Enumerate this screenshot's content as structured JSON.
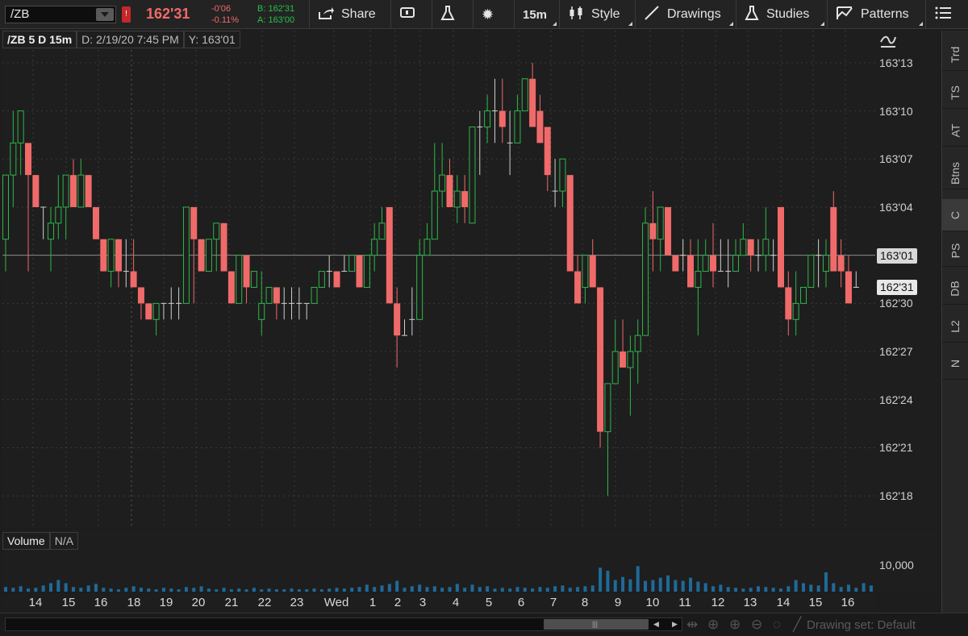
{
  "toolbar": {
    "symbol": "/ZB",
    "alert_badge": "!",
    "last_price": "162'31",
    "net_change": "-0'06",
    "pct_change": "-0.11%",
    "bid": "B: 162'31",
    "ask": "A: 163'00",
    "buttons": [
      {
        "id": "share",
        "label": "Share",
        "icon": "share-icon"
      },
      {
        "id": "messages",
        "label": "",
        "icon": "message-icon"
      },
      {
        "id": "lab",
        "label": "",
        "icon": "flask-icon"
      },
      {
        "id": "settings",
        "label": "",
        "icon": "gear-icon"
      },
      {
        "id": "timeframe",
        "label": "15m",
        "icon": ""
      },
      {
        "id": "style",
        "label": "Style",
        "icon": "candle-icon"
      },
      {
        "id": "drawings",
        "label": "Drawings",
        "icon": "pencil-icon"
      },
      {
        "id": "studies",
        "label": "Studies",
        "icon": "flask-icon"
      },
      {
        "id": "patterns",
        "label": "Patterns",
        "icon": "pattern-icon"
      },
      {
        "id": "grid",
        "label": "",
        "icon": "grid-icon"
      }
    ]
  },
  "info_bar": {
    "symbol_period": "/ZB 5 D 15m",
    "date": "D: 2/19/20 7:45 PM",
    "y_value": "Y: 163'01"
  },
  "volume_header": {
    "label": "Volume",
    "value": "N/A"
  },
  "volume_axis_label": "10,000",
  "sidebar_tabs": [
    "Trd",
    "TS",
    "AT",
    "Btns",
    "C",
    "PS",
    "DB",
    "L2",
    "N"
  ],
  "active_sidebar_tab": "C",
  "bottom": {
    "drawing_set": "Drawing set: Default"
  },
  "colors": {
    "up": "#2db84a",
    "down": "#f06a6a",
    "grid": "#3a3a3a",
    "volume": "#1f6a9a"
  },
  "chart_data": {
    "type": "candlestick",
    "price_unit": "32nds",
    "y_ticks": [
      "163'13",
      "163'10",
      "163'07",
      "163'04",
      "163'01",
      "162'30",
      "162'27",
      "162'24",
      "162'21",
      "162'18"
    ],
    "current_price_label": "162'31",
    "crosshair_price_label": "163'01",
    "x_labels": [
      "14",
      "15",
      "16",
      "18",
      "19",
      "20",
      "21",
      "22",
      "23",
      "Wed",
      "1",
      "2",
      "3",
      "4",
      "5",
      "6",
      "7",
      "8",
      "9",
      "10",
      "11",
      "12",
      "13",
      "14",
      "15",
      "16"
    ],
    "candles": [
      {
        "o": 163.0625,
        "h": 163.1875,
        "l": 163.0,
        "c": 163.1875
      },
      {
        "o": 163.1875,
        "h": 163.3125,
        "l": 163.125,
        "c": 163.25
      },
      {
        "o": 163.25,
        "h": 163.3125,
        "l": 163.1875,
        "c": 163.3125
      },
      {
        "o": 163.25,
        "h": 163.25,
        "l": 163.0,
        "c": 163.1875
      },
      {
        "o": 163.1875,
        "h": 163.1875,
        "l": 163.125,
        "c": 163.125
      },
      {
        "o": 163.125,
        "h": 163.125,
        "l": 163.0625,
        "c": 163.125
      },
      {
        "o": 163.0625,
        "h": 163.125,
        "l": 163.0,
        "c": 163.0938
      },
      {
        "o": 163.0938,
        "h": 163.1875,
        "l": 163.0625,
        "c": 163.125
      },
      {
        "o": 163.125,
        "h": 163.1875,
        "l": 163.0625,
        "c": 163.1875
      },
      {
        "o": 163.1875,
        "h": 163.2188,
        "l": 163.125,
        "c": 163.125
      },
      {
        "o": 163.125,
        "h": 163.2188,
        "l": 163.125,
        "c": 163.1875
      },
      {
        "o": 163.1875,
        "h": 163.1875,
        "l": 163.125,
        "c": 163.125
      },
      {
        "o": 163.125,
        "h": 163.125,
        "l": 163.0625,
        "c": 163.0625
      },
      {
        "o": 163.0625,
        "h": 163.0625,
        "l": 163.0,
        "c": 163.0
      },
      {
        "o": 163.0,
        "h": 163.0625,
        "l": 162.9688,
        "c": 163.0625
      },
      {
        "o": 163.0625,
        "h": 163.0625,
        "l": 162.9688,
        "c": 163.0
      },
      {
        "o": 163.0,
        "h": 163.0625,
        "l": 162.9688,
        "c": 163.0
      },
      {
        "o": 163.0,
        "h": 163.0625,
        "l": 162.9688,
        "c": 162.9688
      },
      {
        "o": 162.9688,
        "h": 162.9688,
        "l": 162.9062,
        "c": 162.9375
      },
      {
        "o": 162.9375,
        "h": 162.9375,
        "l": 162.9062,
        "c": 162.9062
      },
      {
        "o": 162.9062,
        "h": 162.9375,
        "l": 162.875,
        "c": 162.9375
      },
      {
        "o": 162.9375,
        "h": 162.9375,
        "l": 162.9062,
        "c": 162.9375
      },
      {
        "o": 162.9375,
        "h": 162.9688,
        "l": 162.9062,
        "c": 162.9375
      },
      {
        "o": 162.9375,
        "h": 162.9688,
        "l": 162.9062,
        "c": 162.9375
      },
      {
        "o": 162.9375,
        "h": 163.125,
        "l": 162.9375,
        "c": 163.125
      },
      {
        "o": 163.125,
        "h": 163.125,
        "l": 162.9375,
        "c": 163.0625
      },
      {
        "o": 163.0625,
        "h": 163.0625,
        "l": 163.0,
        "c": 163.0
      },
      {
        "o": 163.0,
        "h": 163.0625,
        "l": 163.0,
        "c": 163.0625
      },
      {
        "o": 163.0625,
        "h": 163.0938,
        "l": 163.0,
        "c": 163.0938
      },
      {
        "o": 163.0938,
        "h": 163.0938,
        "l": 163.0,
        "c": 163.0
      },
      {
        "o": 163.0,
        "h": 163.0,
        "l": 162.9375,
        "c": 162.9375
      },
      {
        "o": 162.9375,
        "h": 163.0312,
        "l": 162.9375,
        "c": 163.0312
      },
      {
        "o": 163.0312,
        "h": 163.0312,
        "l": 162.9375,
        "c": 162.9688
      },
      {
        "o": 162.9688,
        "h": 163.0,
        "l": 162.9688,
        "c": 163.0
      },
      {
        "o": 162.9062,
        "h": 163.0,
        "l": 162.875,
        "c": 162.9375
      },
      {
        "o": 162.9375,
        "h": 162.9688,
        "l": 162.9375,
        "c": 162.9688
      },
      {
        "o": 162.9688,
        "h": 162.9688,
        "l": 162.9062,
        "c": 162.9375
      },
      {
        "o": 162.9375,
        "h": 162.9688,
        "l": 162.9062,
        "c": 162.9375
      },
      {
        "o": 162.9375,
        "h": 162.9688,
        "l": 162.9062,
        "c": 162.9375
      },
      {
        "o": 162.9375,
        "h": 162.9688,
        "l": 162.9062,
        "c": 162.9375
      },
      {
        "o": 162.9375,
        "h": 162.9375,
        "l": 162.9062,
        "c": 162.9375
      },
      {
        "o": 162.9375,
        "h": 162.9688,
        "l": 162.9375,
        "c": 162.9688
      },
      {
        "o": 162.9688,
        "h": 163.0,
        "l": 162.9688,
        "c": 163.0
      },
      {
        "o": 163.0,
        "h": 163.0312,
        "l": 162.9688,
        "c": 163.0
      },
      {
        "o": 163.0,
        "h": 163.0,
        "l": 162.9688,
        "c": 162.9688
      },
      {
        "o": 163.0,
        "h": 163.0312,
        "l": 163.0,
        "c": 163.0
      },
      {
        "o": 163.0,
        "h": 163.0312,
        "l": 163.0,
        "c": 163.0312
      },
      {
        "o": 163.0312,
        "h": 163.0312,
        "l": 162.9688,
        "c": 162.9688
      },
      {
        "o": 162.9688,
        "h": 163.0312,
        "l": 162.9688,
        "c": 163.0312
      },
      {
        "o": 163.0312,
        "h": 163.0938,
        "l": 163.0,
        "c": 163.0625
      },
      {
        "o": 163.0625,
        "h": 163.125,
        "l": 163.0625,
        "c": 163.0938
      },
      {
        "o": 163.125,
        "h": 163.125,
        "l": 162.9375,
        "c": 162.9375
      },
      {
        "o": 162.9375,
        "h": 162.9688,
        "l": 162.8125,
        "c": 162.875
      },
      {
        "o": 162.875,
        "h": 162.9062,
        "l": 162.875,
        "c": 162.875
      },
      {
        "o": 162.9062,
        "h": 162.9688,
        "l": 162.875,
        "c": 162.9062
      },
      {
        "o": 162.9062,
        "h": 163.0625,
        "l": 162.9062,
        "c": 163.0312
      },
      {
        "o": 163.0312,
        "h": 163.0938,
        "l": 163.0312,
        "c": 163.0625
      },
      {
        "o": 163.0625,
        "h": 163.25,
        "l": 163.0625,
        "c": 163.1562
      },
      {
        "o": 163.1562,
        "h": 163.25,
        "l": 163.125,
        "c": 163.1875
      },
      {
        "o": 163.1875,
        "h": 163.2188,
        "l": 163.125,
        "c": 163.125
      },
      {
        "o": 163.125,
        "h": 163.1875,
        "l": 163.0938,
        "c": 163.1562
      },
      {
        "o": 163.1562,
        "h": 163.1875,
        "l": 163.0938,
        "c": 163.125
      },
      {
        "o": 163.0938,
        "h": 163.2812,
        "l": 163.0938,
        "c": 163.2812
      },
      {
        "o": 163.2812,
        "h": 163.3125,
        "l": 163.1875,
        "c": 163.2812
      },
      {
        "o": 163.2812,
        "h": 163.3438,
        "l": 163.25,
        "c": 163.3125
      },
      {
        "o": 163.3125,
        "h": 163.375,
        "l": 163.25,
        "c": 163.3125
      },
      {
        "o": 163.3125,
        "h": 163.375,
        "l": 163.25,
        "c": 163.2812
      },
      {
        "o": 163.25,
        "h": 163.3125,
        "l": 163.1875,
        "c": 163.25
      },
      {
        "o": 163.25,
        "h": 163.3438,
        "l": 163.25,
        "c": 163.3125
      },
      {
        "o": 163.3125,
        "h": 163.375,
        "l": 163.3125,
        "c": 163.375
      },
      {
        "o": 163.375,
        "h": 163.4062,
        "l": 163.2812,
        "c": 163.2812
      },
      {
        "o": 163.3125,
        "h": 163.3438,
        "l": 163.25,
        "c": 163.25
      },
      {
        "o": 163.2812,
        "h": 163.2812,
        "l": 163.1562,
        "c": 163.1875
      },
      {
        "o": 163.1562,
        "h": 163.2188,
        "l": 163.125,
        "c": 163.1562
      },
      {
        "o": 163.1562,
        "h": 163.2188,
        "l": 163.125,
        "c": 163.2188
      },
      {
        "o": 163.1875,
        "h": 163.1875,
        "l": 163.0,
        "c": 163.0
      },
      {
        "o": 163.0,
        "h": 163.0312,
        "l": 162.9375,
        "c": 162.9375
      },
      {
        "o": 162.9688,
        "h": 163.0312,
        "l": 162.9375,
        "c": 163.0312
      },
      {
        "o": 163.0312,
        "h": 163.0625,
        "l": 162.9688,
        "c": 162.9688
      },
      {
        "o": 162.9688,
        "h": 162.9688,
        "l": 162.6562,
        "c": 162.6875
      },
      {
        "o": 162.6875,
        "h": 162.7812,
        "l": 162.5625,
        "c": 162.7812
      },
      {
        "o": 162.7812,
        "h": 162.9062,
        "l": 162.7812,
        "c": 162.8438
      },
      {
        "o": 162.8438,
        "h": 162.9062,
        "l": 162.8125,
        "c": 162.8125
      },
      {
        "o": 162.8125,
        "h": 162.875,
        "l": 162.7188,
        "c": 162.8438
      },
      {
        "o": 162.8438,
        "h": 162.9062,
        "l": 162.7812,
        "c": 162.875
      },
      {
        "o": 162.875,
        "h": 163.125,
        "l": 162.875,
        "c": 163.0938
      },
      {
        "o": 163.0938,
        "h": 163.1562,
        "l": 163.0,
        "c": 163.0625
      },
      {
        "o": 163.0625,
        "h": 163.125,
        "l": 163.0,
        "c": 163.125
      },
      {
        "o": 163.125,
        "h": 163.125,
        "l": 163.0312,
        "c": 163.0312
      },
      {
        "o": 163.0312,
        "h": 163.0312,
        "l": 163.0,
        "c": 163.0
      },
      {
        "o": 163.0312,
        "h": 163.0625,
        "l": 163.0,
        "c": 163.0312
      },
      {
        "o": 163.0312,
        "h": 163.0625,
        "l": 162.9688,
        "c": 162.9688
      },
      {
        "o": 162.9688,
        "h": 163.0625,
        "l": 162.875,
        "c": 163.0
      },
      {
        "o": 163.0,
        "h": 163.0625,
        "l": 163.0,
        "c": 163.0312
      },
      {
        "o": 163.0312,
        "h": 163.0938,
        "l": 162.9688,
        "c": 163.0
      },
      {
        "o": 163.0,
        "h": 163.0625,
        "l": 163.0,
        "c": 163.0
      },
      {
        "o": 163.0,
        "h": 163.0625,
        "l": 162.9688,
        "c": 163.0
      },
      {
        "o": 163.0,
        "h": 163.0625,
        "l": 163.0,
        "c": 163.0312
      },
      {
        "o": 163.0312,
        "h": 163.0938,
        "l": 163.0312,
        "c": 163.0625
      },
      {
        "o": 163.0625,
        "h": 163.0625,
        "l": 163.0,
        "c": 163.0312
      },
      {
        "o": 163.0312,
        "h": 163.0625,
        "l": 163.0,
        "c": 163.0312
      },
      {
        "o": 163.0312,
        "h": 163.125,
        "l": 163.0,
        "c": 163.0625
      },
      {
        "o": 163.0312,
        "h": 163.0625,
        "l": 163.0,
        "c": 163.0312
      },
      {
        "o": 163.125,
        "h": 163.125,
        "l": 162.9688,
        "c": 162.9688
      },
      {
        "o": 162.9688,
        "h": 163.0,
        "l": 162.875,
        "c": 162.9062
      },
      {
        "o": 162.9062,
        "h": 163.0,
        "l": 162.875,
        "c": 162.9375
      },
      {
        "o": 162.9375,
        "h": 162.9688,
        "l": 162.9375,
        "c": 162.9688
      },
      {
        "o": 162.9688,
        "h": 163.0312,
        "l": 162.9688,
        "c": 163.0312
      },
      {
        "o": 163.0312,
        "h": 163.0625,
        "l": 162.9688,
        "c": 163.0312
      },
      {
        "o": 163.0,
        "h": 163.0625,
        "l": 162.9688,
        "c": 163.0312
      },
      {
        "o": 163.125,
        "h": 163.1562,
        "l": 163.0,
        "c": 163.0
      },
      {
        "o": 163.0312,
        "h": 163.0625,
        "l": 162.9688,
        "c": 163.0
      },
      {
        "o": 163.0,
        "h": 163.0312,
        "l": 162.9375,
        "c": 162.9375
      },
      {
        "o": 162.9688,
        "h": 163.0,
        "l": 162.9688,
        "c": 162.9688
      }
    ],
    "volume": [
      0.12,
      0.1,
      0.14,
      0.08,
      0.1,
      0.16,
      0.22,
      0.3,
      0.22,
      0.12,
      0.1,
      0.16,
      0.2,
      0.1,
      0.08,
      0.06,
      0.1,
      0.14,
      0.1,
      0.08,
      0.06,
      0.1,
      0.08,
      0.06,
      0.12,
      0.1,
      0.14,
      0.08,
      0.06,
      0.1,
      0.06,
      0.08,
      0.06,
      0.1,
      0.06,
      0.08,
      0.06,
      0.06,
      0.08,
      0.06,
      0.06,
      0.08,
      0.06,
      0.08,
      0.1,
      0.08,
      0.1,
      0.12,
      0.18,
      0.12,
      0.16,
      0.2,
      0.28,
      0.1,
      0.14,
      0.18,
      0.12,
      0.14,
      0.1,
      0.12,
      0.2,
      0.1,
      0.18,
      0.12,
      0.14,
      0.08,
      0.1,
      0.08,
      0.12,
      0.1,
      0.08,
      0.12,
      0.1,
      0.14,
      0.16,
      0.1,
      0.12,
      0.14,
      0.16,
      0.62,
      0.54,
      0.3,
      0.38,
      0.32,
      0.66,
      0.28,
      0.3,
      0.36,
      0.42,
      0.3,
      0.28,
      0.36,
      0.26,
      0.22,
      0.14,
      0.18,
      0.12,
      0.1,
      0.08,
      0.1,
      0.14,
      0.12,
      0.1,
      0.08,
      0.14,
      0.3,
      0.22,
      0.18,
      0.16,
      0.5,
      0.22,
      0.12,
      0.18,
      0.1,
      0.22,
      0.16
    ],
    "y_min": 162.5,
    "y_max": 163.4688,
    "volume_max": 11000
  }
}
